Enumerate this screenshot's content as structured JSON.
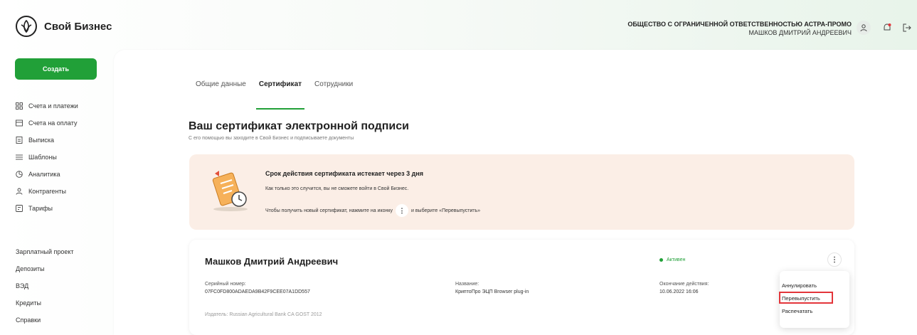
{
  "header": {
    "app_name": "Свой Бизнес",
    "org_name": "ОБЩЕСТВО С ОГРАНИЧЕННОЙ ОТВЕТСТВЕННОСТЬЮ АСТРА-ПРОМО",
    "user_name": "МАШКОВ ДМИТРИЙ АНДРЕЕВИЧ",
    "icons": [
      "user-icon",
      "notifications-icon",
      "logout-icon"
    ]
  },
  "sidebar": {
    "create_label": "Создать",
    "items": [
      {
        "label": "Счета и платежи",
        "icon": "grid-icon"
      },
      {
        "label": "Счета на оплату",
        "icon": "invoice-icon"
      },
      {
        "label": "Выписка",
        "icon": "statement-icon"
      },
      {
        "label": "Шаблоны",
        "icon": "list-icon"
      },
      {
        "label": "Аналитика",
        "icon": "analytics-icon"
      },
      {
        "label": "Контрагенты",
        "icon": "person-icon"
      },
      {
        "label": "Тарифы",
        "icon": "tariff-icon"
      }
    ],
    "sections": [
      "Зарплатный проект",
      "Депозиты",
      "ВЭД",
      "Кредиты",
      "Справки"
    ]
  },
  "tabs": [
    {
      "label": "Общие данные",
      "active": false
    },
    {
      "label": "Сертификат",
      "active": true
    },
    {
      "label": "Сотрудники",
      "active": false
    }
  ],
  "page": {
    "title": "Ваш сертификат электронной подписи",
    "subtitle": "С его помощью вы заходите в Свой Бизнес и подписываете документы"
  },
  "warning": {
    "title": "Срок действия сертификата истекает через 3 дня",
    "line1": "Как только это случится, вы не сможете войти в Свой Бизнес.",
    "line2_before": "Чтобы получить новый сертификат, нажмите на иконку",
    "kebab_glyph": "⋮",
    "line2_after": "и выберите «Перевыпустить»"
  },
  "certificate": {
    "owner": "Машков Дмитрий Андреевич",
    "status": "Активен",
    "kebab_glyph": "⋮",
    "serial_label": "Серийный номер:",
    "serial_value": "07FC0FD800ADAEDA9B42F9CEE07A1DD557",
    "name_label": "Название:",
    "name_value": "КриптоПро ЭЦП Browser plug-in",
    "expiry_label": "Окончание действия:",
    "expiry_value": "10.06.2022 16:06",
    "issuer": "Издатель: Russian Agricultural Bank CA GOST 2012"
  },
  "menu": {
    "items": [
      "Аннулировать",
      "Перевыпустить",
      "Распечатать"
    ],
    "highlighted_index": 1,
    "highlight_color": "#e3353a"
  },
  "colors": {
    "accent": "#21a038",
    "warning_bg": "#fbeee6"
  }
}
